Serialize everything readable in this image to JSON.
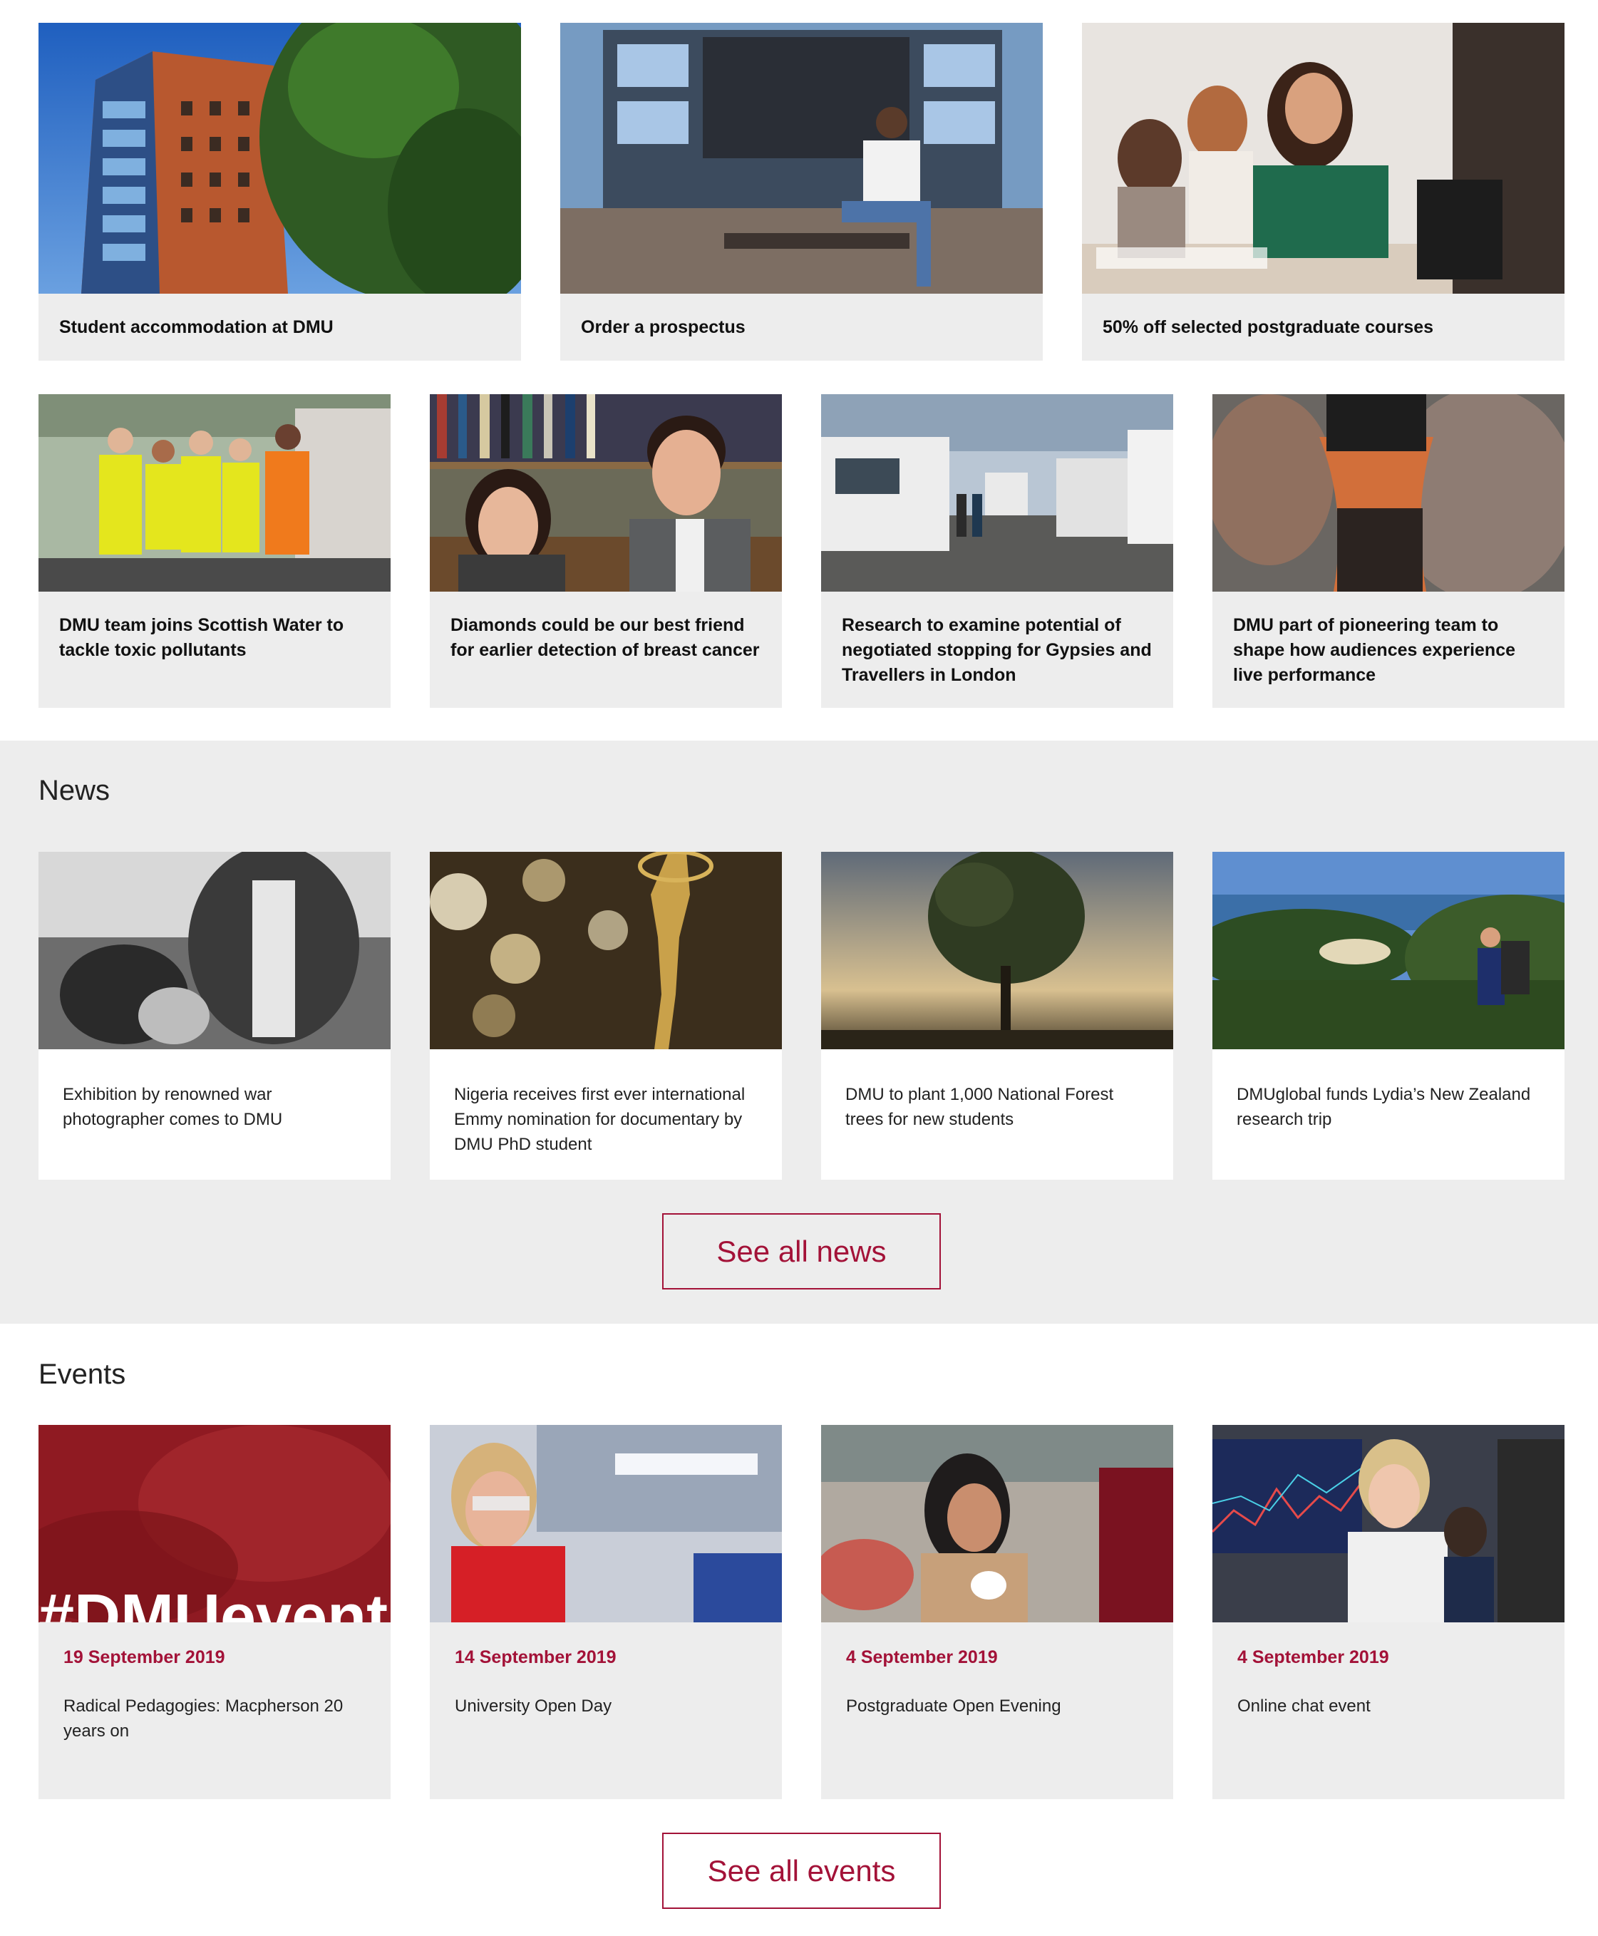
{
  "promos_top": [
    {
      "caption": "Student accommodation at DMU",
      "image": "student-accommodation-building-photo"
    },
    {
      "caption": "Order a prospectus",
      "image": "student-sitting-in-front-of-screen-photo"
    },
    {
      "caption": "50% off selected postgraduate courses",
      "image": "students-in-seminar-photo"
    }
  ],
  "features": [
    {
      "caption": "DMU team joins Scottish Water to tackle toxic pollutants",
      "image": "team-in-hi-vis-jackets-photo"
    },
    {
      "caption": "Diamonds could be our best friend for earlier detection of breast cancer",
      "image": "two-researchers-bookshelf-photo"
    },
    {
      "caption": "Research to examine potential of negotiated stopping for Gypsies and Travellers in London",
      "image": "caravans-site-photo"
    },
    {
      "caption": "DMU part of pioneering team to shape how audiences experience live performance",
      "image": "vr-headset-sparks-photo"
    }
  ],
  "news": {
    "heading": "News",
    "items": [
      {
        "title": "Exhibition by renowned war photographer comes to DMU",
        "image": "refugees-bw-photo"
      },
      {
        "title": "Nigeria receives first ever international Emmy nomination for documentary by DMU PhD student",
        "image": "emmy-statuette-photo"
      },
      {
        "title": "DMU to plant 1,000 National Forest trees for new students",
        "image": "tree-at-sunset-photo"
      },
      {
        "title": "DMUglobal funds Lydia’s New Zealand research trip",
        "image": "hiker-new-zealand-coast-photo"
      }
    ],
    "see_all": "See all news"
  },
  "events": {
    "heading": "Events",
    "items": [
      {
        "date": "19 September 2019",
        "title": "Radical Pedagogies: Macpherson 20 years on",
        "image": "dmu-events-red-banner",
        "banner_text": "#DMUevents"
      },
      {
        "date": "14 September 2019",
        "title": "University Open Day",
        "image": "student-in-lab-goggles-photo"
      },
      {
        "date": "4 September 2019",
        "title": "Postgraduate Open Evening",
        "image": "student-with-coffee-photo"
      },
      {
        "date": "4 September 2019",
        "title": "Online chat event",
        "image": "student-at-trading-screens-photo"
      }
    ],
    "see_all": "See all events"
  },
  "colors": {
    "accent": "#a31238",
    "band": "#ededed",
    "card": "#ededed"
  }
}
